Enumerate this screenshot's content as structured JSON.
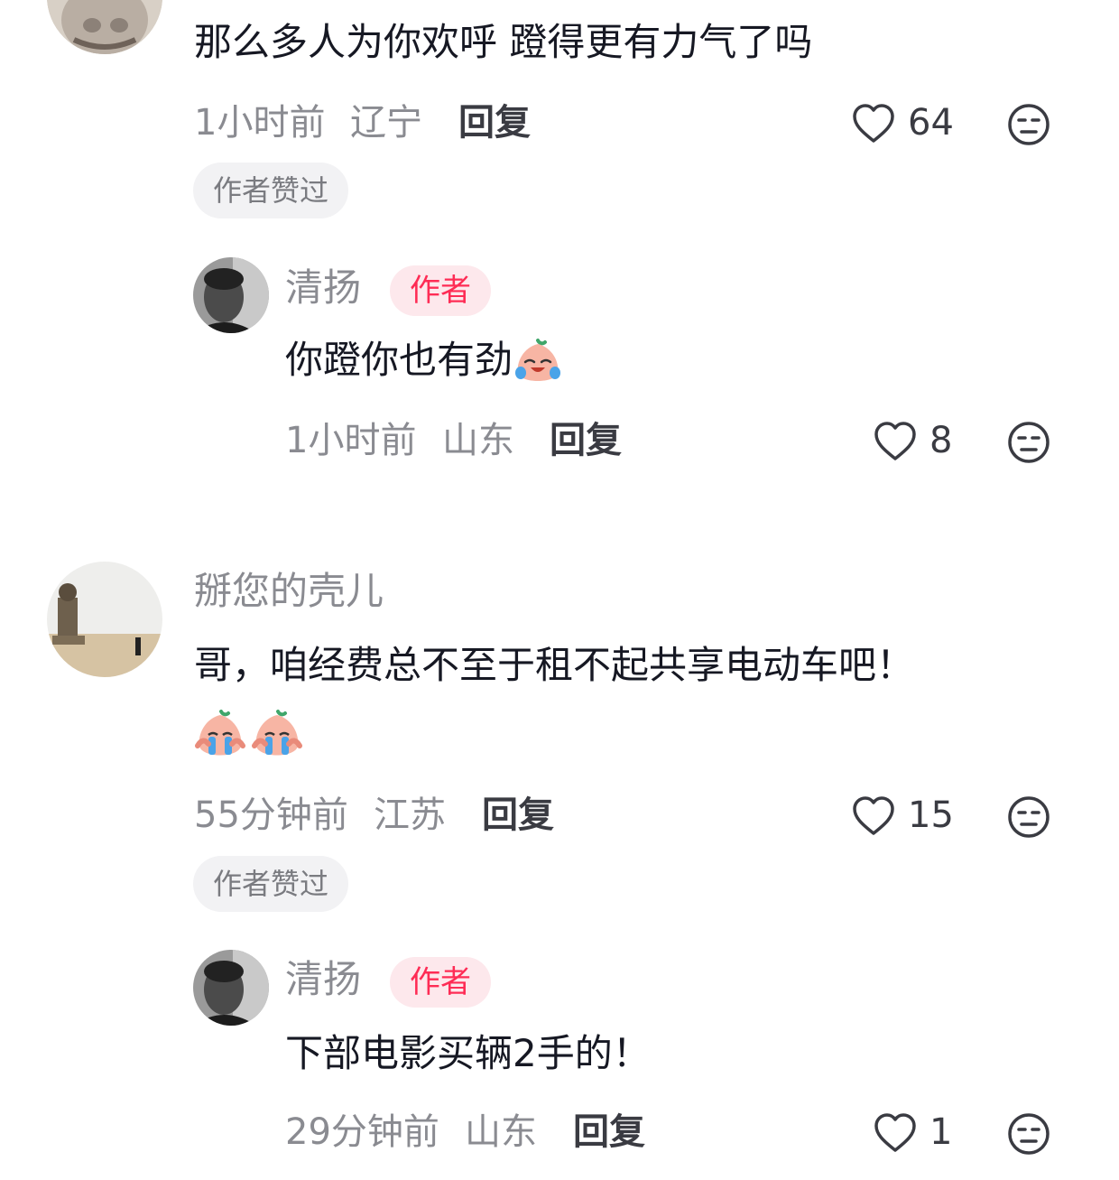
{
  "comments": [
    {
      "text": "那么多人为你欢呼 蹬得更有力气了吗",
      "time": "1小时前",
      "location": "辽宁",
      "reply_label": "回复",
      "likes": "64",
      "tag": "作者赞过",
      "avatar_icon": "cat-avatar",
      "reply": {
        "name": "清扬",
        "badge": "作者",
        "text": "你蹬你也有劲",
        "emoji": "laugh-cry-emoji",
        "time": "1小时前",
        "location": "山东",
        "reply_label": "回复",
        "likes": "8",
        "avatar_icon": "man-portrait-avatar"
      }
    },
    {
      "name": "掰您的壳儿",
      "text": "哥，咱经费总不至于租不起共享电动车吧！",
      "emoji": "crying-emoji",
      "time": "55分钟前",
      "location": "江苏",
      "reply_label": "回复",
      "likes": "15",
      "tag": "作者赞过",
      "avatar_icon": "statue-landscape-avatar",
      "reply": {
        "name": "清扬",
        "badge": "作者",
        "text": "下部电影买辆2手的！",
        "time": "29分钟前",
        "location": "山东",
        "reply_label": "回复",
        "likes": "1",
        "avatar_icon": "man-portrait-avatar"
      }
    }
  ],
  "colors": {
    "accent": "#fe2c55",
    "text_primary": "#161823",
    "text_secondary": "#8a8b91",
    "chip_bg": "#f2f2f4",
    "badge_bg": "#fde8ec"
  }
}
